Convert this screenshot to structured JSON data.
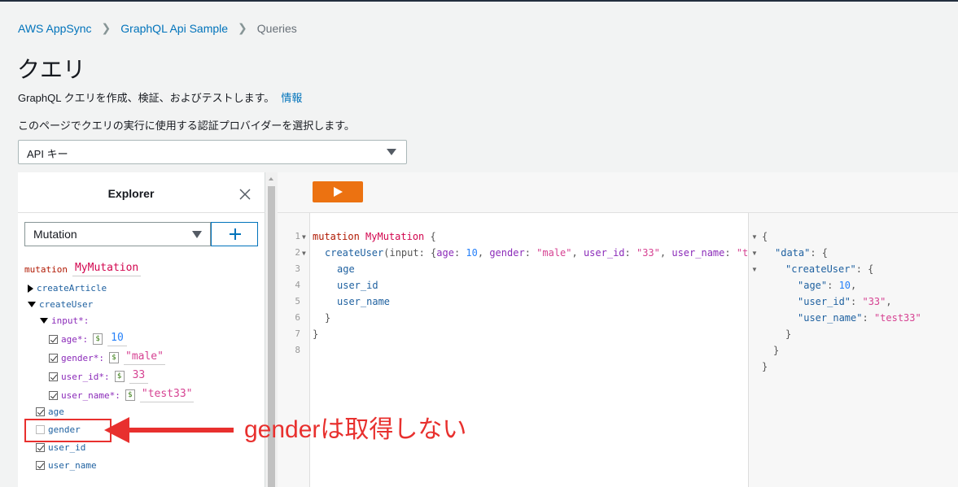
{
  "breadcrumb": {
    "items": [
      "AWS AppSync",
      "GraphQL Api Sample",
      "Queries"
    ]
  },
  "page": {
    "title": "クエリ",
    "description": "GraphQL クエリを作成、検証、およびテストします。",
    "info_link": "情報",
    "auth_prompt": "このページでクエリの実行に使用する認証プロバイダーを選択します。",
    "auth_selected": "API キー"
  },
  "explorer": {
    "title": "Explorer",
    "operation_type": "Mutation",
    "op_keyword": "mutation",
    "op_name": "MyMutation",
    "fields": {
      "createArticle": "createArticle",
      "createUser": "createUser",
      "input": "input*:",
      "age_arg": "age*:",
      "age_val": "10",
      "gender_arg": "gender*:",
      "gender_val": "male",
      "user_id_arg": "user_id*:",
      "user_id_val": "33",
      "user_name_arg": "user_name*:",
      "user_name_val": "test33",
      "age": "age",
      "gender": "gender",
      "user_id": "user_id",
      "user_name": "user_name"
    },
    "dollar": "$",
    "quote": "\""
  },
  "editor": {
    "line_numbers": [
      "1",
      "2",
      "3",
      "4",
      "5",
      "6",
      "7",
      "8"
    ],
    "l1_kw": "mutation",
    "l1_name": "MyMutation",
    "l1_brace": " {",
    "l2_fn": "createUser",
    "l2_open": "(input: {",
    "l2_age": "age",
    "l2_age_val": "10",
    "l2_gender": "gender",
    "l2_gender_val": "\"male\"",
    "l2_uid": "user_id",
    "l2_uid_val": "\"33\"",
    "l2_uname": "user_name",
    "l2_uname_val": "\"te",
    "l3": "age",
    "l4": "user_id",
    "l5": "user_name",
    "l6": "}",
    "l7": "}"
  },
  "result": {
    "open": "{",
    "data_key": "\"data\"",
    "create_key": "\"createUser\"",
    "age_key": "\"age\"",
    "age_val": "10",
    "uid_key": "\"user_id\"",
    "uid_val": "\"33\"",
    "uname_key": "\"user_name\"",
    "uname_val": "\"test33\"",
    "close": "}"
  },
  "annotation": {
    "text": "genderは取得しない",
    "color": "#e8302e"
  },
  "colors": {
    "accent_orange": "#ec7211",
    "link_blue": "#0073bb"
  }
}
